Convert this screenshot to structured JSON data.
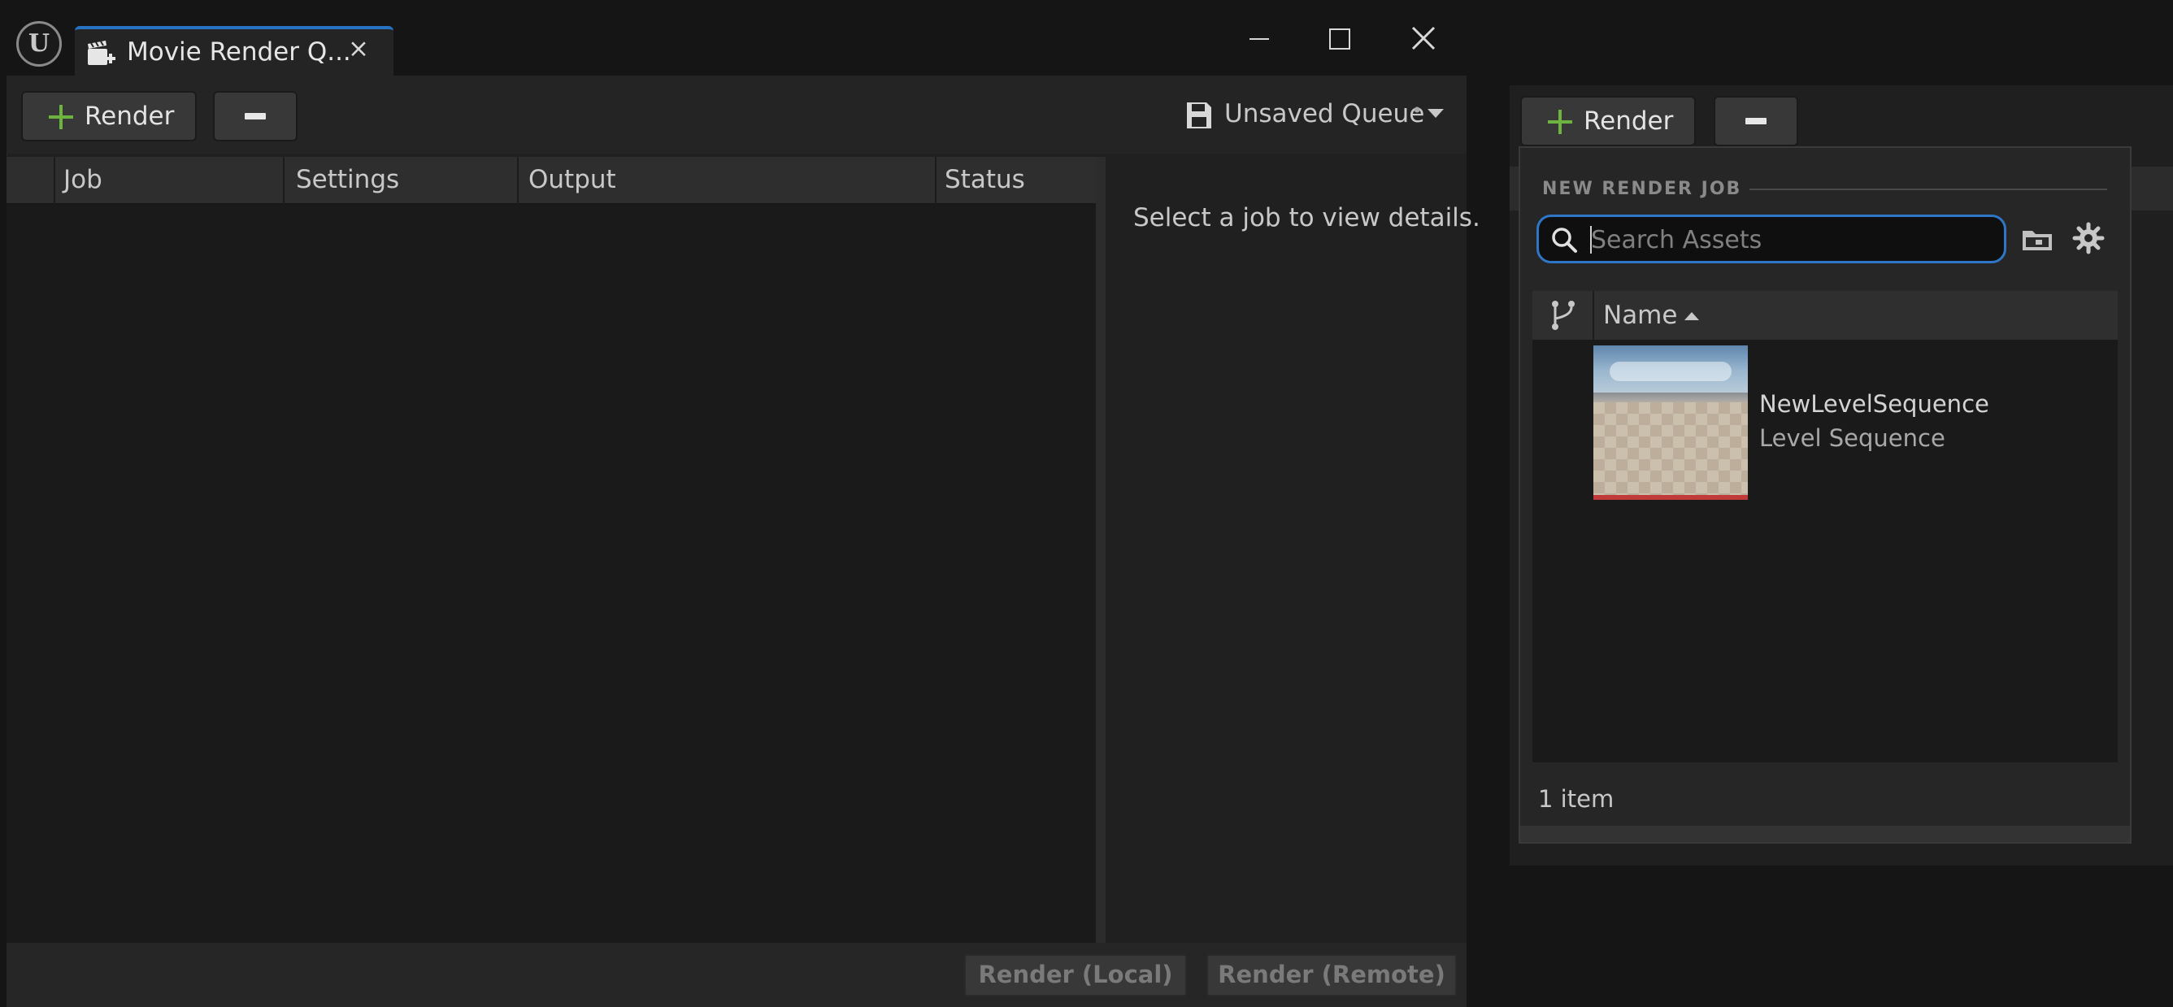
{
  "window": {
    "tab_title": "Movie Render Q...",
    "tab_close": "×"
  },
  "toolbar": {
    "render_label": "Render",
    "queue_label": "Unsaved Queue",
    "queue_dirty_marker": "•"
  },
  "job_table": {
    "columns": [
      "Job",
      "Settings",
      "Output",
      "Status"
    ]
  },
  "details": {
    "empty_message": "Select a job to view details."
  },
  "footer": {
    "render_local": "Render (Local)",
    "render_remote": "Render (Remote)"
  },
  "popup": {
    "heading": "NEW RENDER JOB",
    "search": {
      "placeholder": "Search Assets",
      "value": ""
    },
    "column_name": "Name",
    "sort": "ascending",
    "assets": [
      {
        "name": "NewLevelSequence",
        "type": "Level Sequence"
      }
    ],
    "item_count": "1 item"
  },
  "icons": {
    "app_logo": "unreal-logo-icon",
    "tab": "movie-render-icon",
    "save": "floppy-disk-icon",
    "search": "search-icon",
    "folder": "folder-icon",
    "settings": "gear-icon",
    "source_control": "branch-icon"
  },
  "colors": {
    "accent_blue": "#2f76c7",
    "plus_green": "#6db33f",
    "thumbnail_bar": "#c03a3a"
  }
}
